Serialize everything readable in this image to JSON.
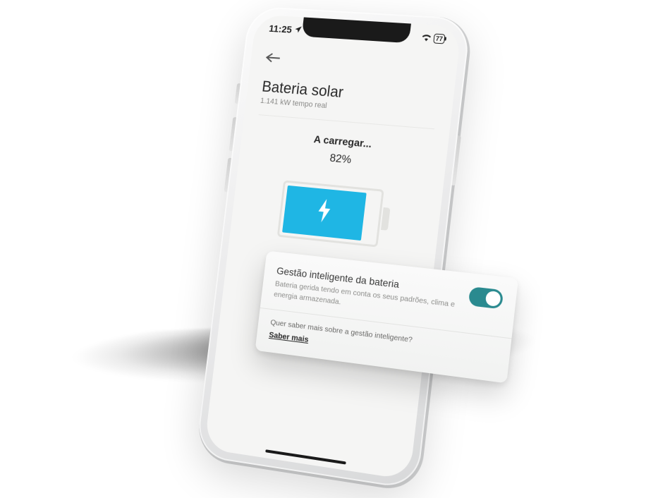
{
  "status": {
    "time": "11:25",
    "battery_percent": "77"
  },
  "header": {
    "title": "Bateria solar",
    "power_value": "1.141 kW",
    "power_label": "tempo real"
  },
  "charging": {
    "label": "A carregar...",
    "percent": "82%"
  },
  "card": {
    "title": "Gestão inteligente da bateria",
    "description": "Bateria gerida tendo em conta os seus padrões, clima e energia armazenada.",
    "question": "Quer saber mais sobre a gestão inteligente?",
    "link": "Saber mais",
    "toggle_on": true
  },
  "colors": {
    "accent_cyan": "#1fb6e4",
    "toggle_teal": "#2a8a8f"
  }
}
